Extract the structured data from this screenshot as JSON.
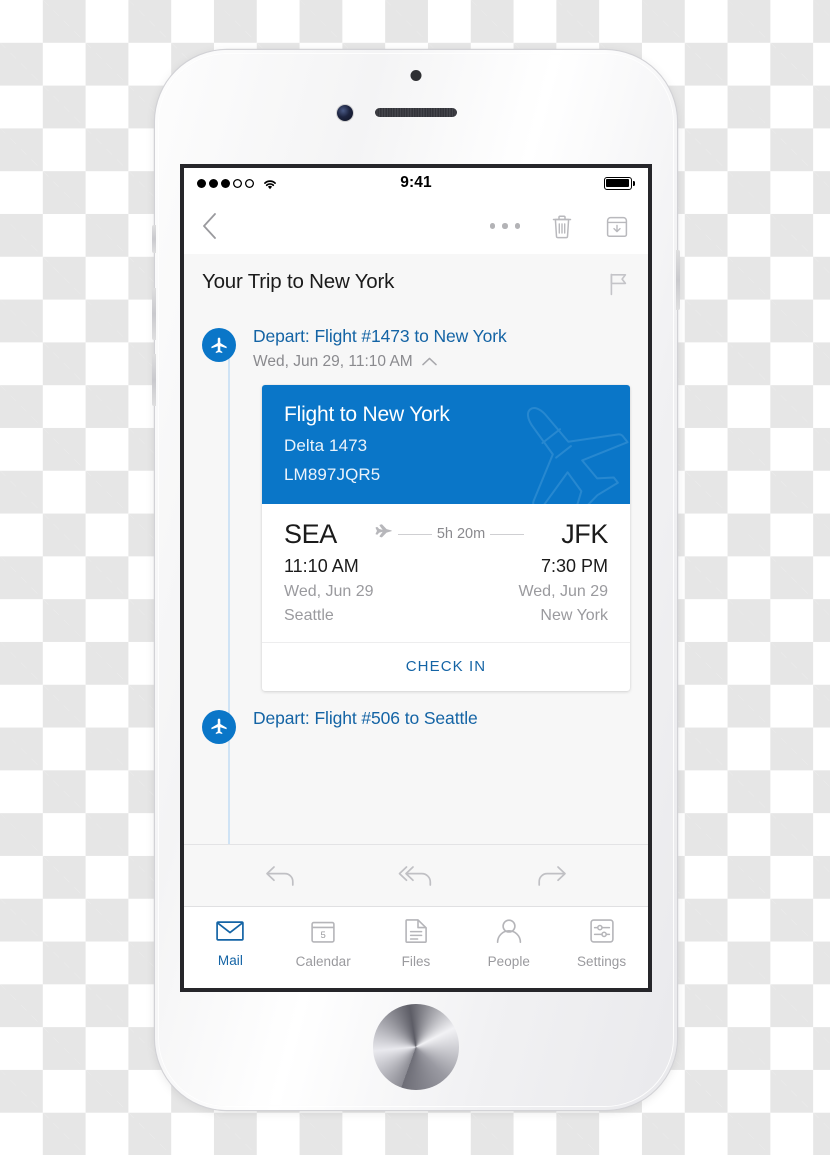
{
  "device": {
    "name": "iphone-white",
    "home_button": "home-button"
  },
  "status_bar": {
    "signal_icon": "signal-dots-icon",
    "signal_bars_filled": 3,
    "signal_bars_total": 5,
    "wifi_icon": "wifi-icon",
    "time": "9:41",
    "battery_icon": "battery-full-icon"
  },
  "navbar": {
    "back_icon": "chevron-left-icon",
    "more_icon": "more-horizontal-icon",
    "delete_icon": "trash-icon",
    "archive_icon": "archive-icon"
  },
  "message": {
    "title": "Your Trip to New York",
    "flag_icon": "flag-icon"
  },
  "flights": [
    {
      "icon": "airplane-icon",
      "link": "Depart: Flight #1473 to New York",
      "datetime": "Wed, Jun 29, 11:10 AM",
      "collapse_icon": "chevron-up-icon"
    },
    {
      "icon": "airplane-icon",
      "link": "Depart: Flight #506 to Seattle"
    }
  ],
  "card": {
    "header": {
      "title": "Flight to New York",
      "carrier": "Delta 1473",
      "confirmation": "LM897JQR5",
      "watermark_icon": "airplane-outline-icon",
      "background_color": "#0a76c8"
    },
    "route": {
      "origin_code": "SEA",
      "destination_code": "JFK",
      "duration": "5h 20m",
      "plane_icon": "airplane-small-icon",
      "depart_time": "11:10 AM",
      "arrive_time": "7:30 PM",
      "depart_date": "Wed, Jun 29",
      "arrive_date": "Wed, Jun 29",
      "origin_city": "Seattle",
      "destination_city": "New York"
    },
    "action_label": "CHECK IN"
  },
  "reply_bar": {
    "reply_icon": "reply-icon",
    "reply_all_icon": "reply-all-icon",
    "forward_icon": "forward-icon"
  },
  "tabbar": {
    "items": [
      {
        "label": "Mail",
        "icon": "mail-icon",
        "active": true
      },
      {
        "label": "Calendar",
        "icon": "calendar-icon",
        "badge": "5",
        "active": false
      },
      {
        "label": "Files",
        "icon": "file-icon",
        "active": false
      },
      {
        "label": "People",
        "icon": "person-icon",
        "active": false
      },
      {
        "label": "Settings",
        "icon": "sliders-icon",
        "active": false
      }
    ]
  },
  "colors": {
    "accent_blue": "#0a76c8",
    "link_blue": "#1464a5",
    "panel_gray": "#f7f7f7",
    "muted_text": "#9a9a9e"
  }
}
